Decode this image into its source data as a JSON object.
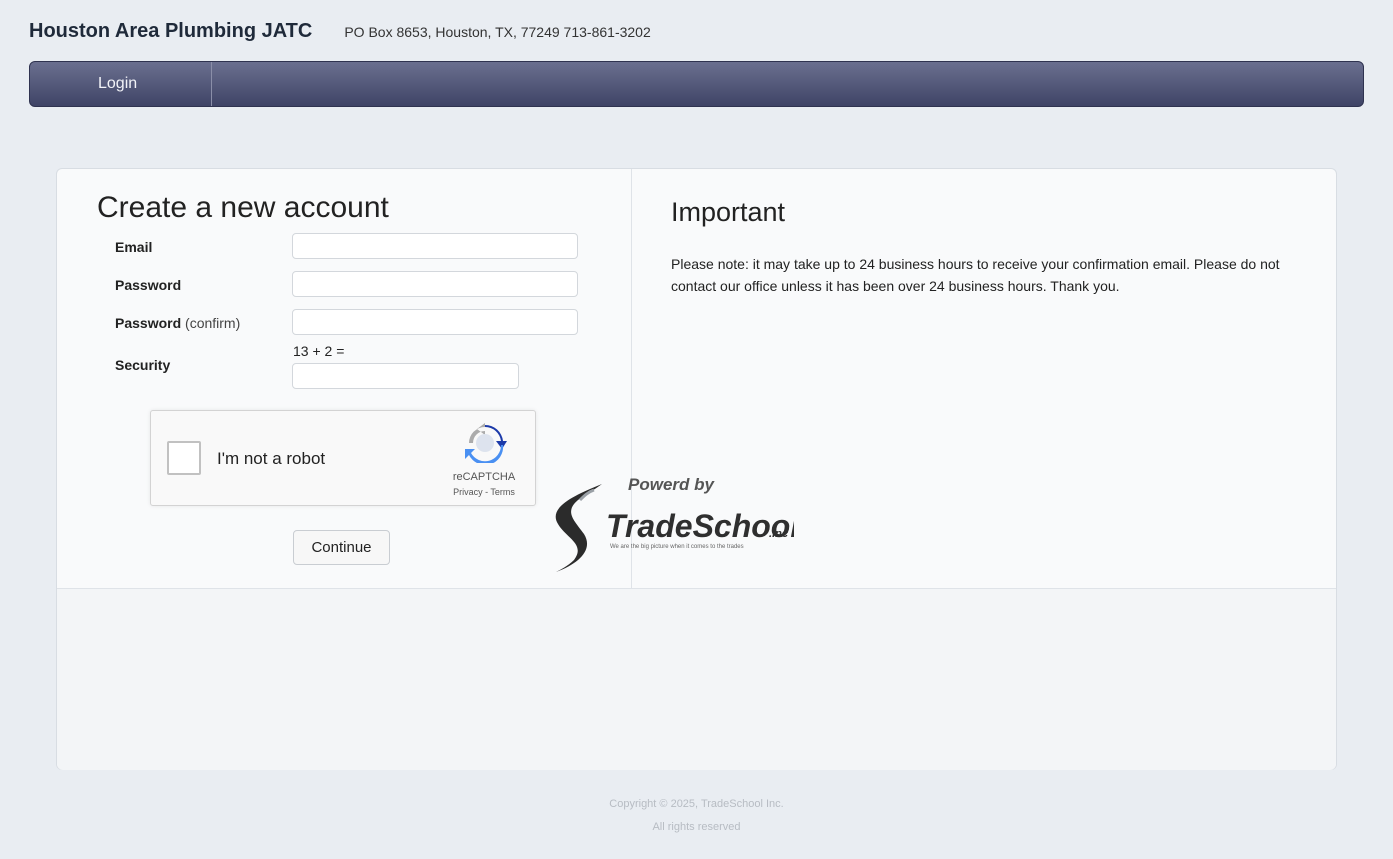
{
  "header": {
    "org_name": "Houston Area Plumbing JATC",
    "contact": "PO Box 8653, Houston, TX, 77249   713-861-3202"
  },
  "nav": {
    "login": "Login"
  },
  "form": {
    "title": "Create a new account",
    "email_label": "Email",
    "password_label": "Password",
    "password_confirm_label": "Password",
    "password_confirm_note": "(confirm)",
    "security_label": "Security",
    "security_question": "13 + 2  =",
    "email_value": "",
    "password_value": "",
    "password_confirm_value": "",
    "security_value": ""
  },
  "recaptcha": {
    "label": "I'm not a robot",
    "brand": "reCAPTCHA",
    "links": "Privacy - Terms",
    "checked": false
  },
  "buttons": {
    "continue": "Continue"
  },
  "important": {
    "title": "Important",
    "text": "Please note: it may take up to 24 business hours to receive your confirmation email. Please do not contact our office unless it has been over 24 business hours. Thank you."
  },
  "footer": {
    "powered_by": "Powerd by",
    "logo_text": "TradeSchool",
    "logo_suffix": ".Inc",
    "tagline": "We are the big picture when it comes to the trades",
    "copyright": "Copyright © 2025, TradeSchool Inc.",
    "rights": "All rights reserved"
  },
  "colors": {
    "navbar": "#4c516f",
    "background": "#e9edf2",
    "panel": "#f9fafb"
  }
}
